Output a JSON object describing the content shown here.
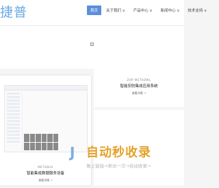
{
  "header": {
    "logo_text": "捷普",
    "nav": [
      {
        "label": "首页",
        "active": true
      },
      {
        "label": "关于我们 ∨",
        "active": false
      },
      {
        "label": "产品中心 ∨",
        "active": false
      },
      {
        "label": "新闻中心 ∨",
        "active": false
      },
      {
        "label": "技术支持 ∨",
        "active": false
      }
    ]
  },
  "products": [
    {
      "subtitle": "ZHP METAOWL",
      "title": "智能安防集成应用系统",
      "more": "查看详情 →"
    },
    {
      "subtitle": "METABUS",
      "title": "智能集成数据服务设备",
      "more": "查看详情 →"
    }
  ],
  "watermark": {
    "title": "自动秒收录",
    "subtitle": "做上链接→来访一次→自动收录→"
  }
}
